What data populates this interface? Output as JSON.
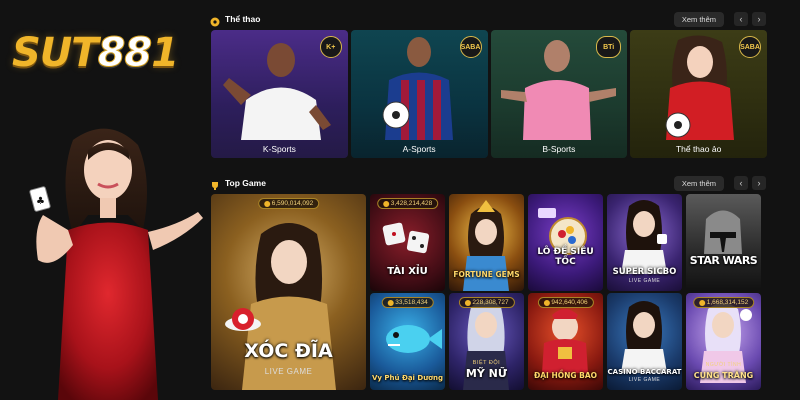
{
  "brand": {
    "logo_text_a": "SUT",
    "logo_text_b": "88",
    "logo_text_c": "1"
  },
  "sports_section": {
    "title": "Thể thao",
    "see_more": "Xem thêm",
    "cards": [
      {
        "label": "K-Sports",
        "badge": "K+"
      },
      {
        "label": "A-Sports",
        "badge": "SABA"
      },
      {
        "label": "B-Sports",
        "badge": "BTi"
      },
      {
        "label": "Thể thao ảo",
        "badge": "SABA"
      }
    ]
  },
  "games_section": {
    "title": "Top Game",
    "see_more": "Xem thêm",
    "featured": {
      "title": "XÓC ĐĨA",
      "subtitle": "LIVE GAME",
      "counter": "6,590,014,092"
    },
    "tiles": [
      {
        "title": "TÀI XỈU",
        "subtitle": "",
        "counter": "3,428,214,428"
      },
      {
        "title": "FORTUNE GEMS",
        "subtitle": "",
        "counter": ""
      },
      {
        "title": "LÔ ĐỀ SIÊU TỐC",
        "subtitle": "",
        "counter": ""
      },
      {
        "title": "SUPER SICBO",
        "subtitle": "LIVE GAME",
        "counter": ""
      },
      {
        "title": "STAR WARS",
        "subtitle": "",
        "counter": ""
      },
      {
        "title": "Vy Phú Đại Dương",
        "subtitle": "",
        "counter": "33,518,434"
      },
      {
        "title": "MỸ NỮ",
        "subtitle": "BIỆT ĐỘI",
        "counter": "228,308,727"
      },
      {
        "title": "ĐẠI HỒNG BAO",
        "subtitle": "",
        "counter": "942,640,406"
      },
      {
        "title": "CASINO BACCARAT",
        "subtitle": "LIVE GAME",
        "counter": ""
      },
      {
        "title": "CUNG TRĂNG",
        "subtitle": "NGƯỜI TÌNH",
        "counter": "1,668,314,152"
      }
    ]
  },
  "colors": {
    "accent": "#f0b52a",
    "background": "#121212"
  }
}
